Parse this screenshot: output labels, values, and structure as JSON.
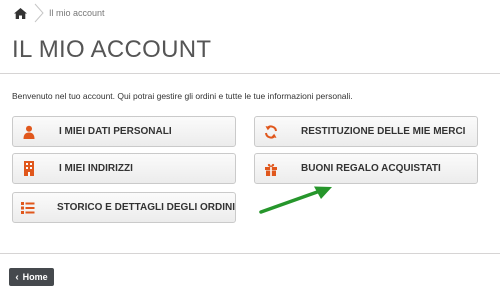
{
  "breadcrumb": {
    "home_icon": "home-icon",
    "current": "Il mio account"
  },
  "page": {
    "title": "IL MIO ACCOUNT",
    "intro": "Benvenuto nel tuo account. Qui potrai gestire gli ordini e tutte le tue informazioni personali."
  },
  "account_links": [
    {
      "label": "I MIEI DATI PERSONALI",
      "icon": "user-icon"
    },
    {
      "label": "RESTITUZIONE DELLE MIE MERCI",
      "icon": "refresh-icon"
    },
    {
      "label": "I MIEI INDIRIZZI",
      "icon": "building-icon"
    },
    {
      "label": "BUONI REGALO ACQUISTATI",
      "icon": "gift-icon"
    },
    {
      "label": "STORICO E DETTAGLI DEGLI ORDINI",
      "icon": "list-icon"
    }
  ],
  "footer": {
    "home_label": "Home"
  },
  "colors": {
    "icon_accent": "#e0571c",
    "arrow": "#26962b",
    "home_button": "#45494d"
  }
}
